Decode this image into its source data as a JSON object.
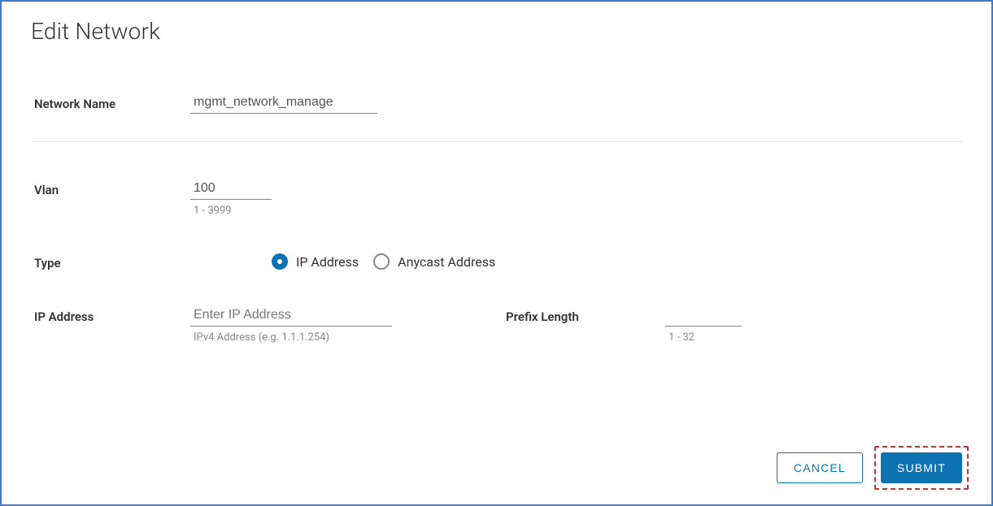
{
  "title": "Edit Network",
  "networkName": {
    "label": "Network Name",
    "value": "mgmt_network_manage"
  },
  "vlan": {
    "label": "Vlan",
    "value": "100",
    "hint": "1 - 3999"
  },
  "type": {
    "label": "Type",
    "options": {
      "ip": "IP Address",
      "anycast": "Anycast Address"
    }
  },
  "ipAddress": {
    "label": "IP Address",
    "placeholder": "Enter IP Address",
    "hint": "IPv4 Address (e.g. 1.1.1.254)"
  },
  "prefixLength": {
    "label": "Prefix Length",
    "hint": "1 - 32"
  },
  "buttons": {
    "cancel": "CANCEL",
    "submit": "SUBMIT"
  }
}
